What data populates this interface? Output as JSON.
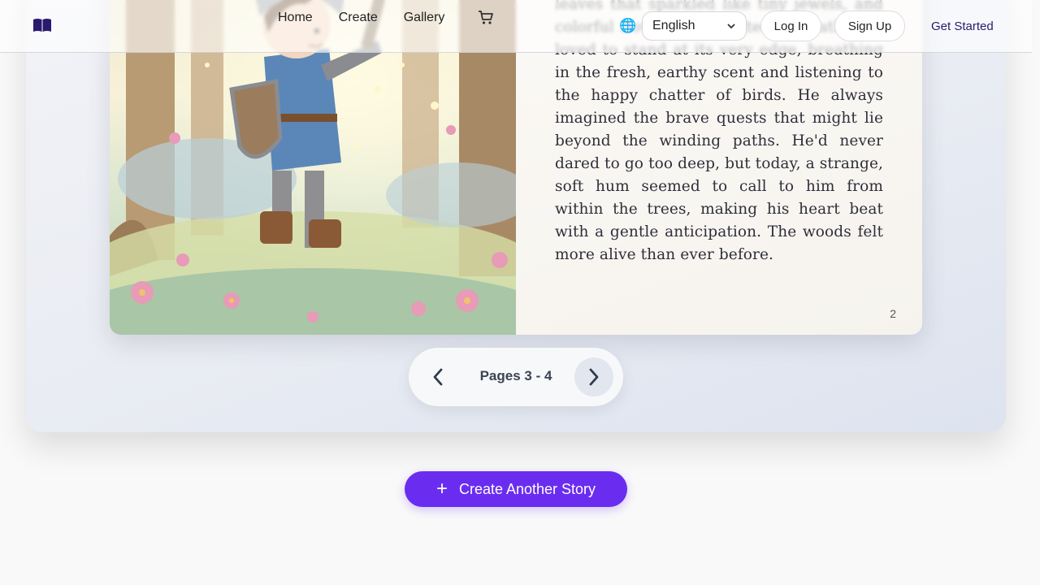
{
  "nav": {
    "links": [
      "Home",
      "Create",
      "Gallery"
    ],
    "language": "English",
    "login_label": "Log In",
    "signup_label": "Sign Up",
    "get_started_label": "Get Started"
  },
  "story": {
    "text": "leaves that sparkled like tiny jewels, and colorful flowers that dotted the path. Leo loved to stand at its very edge, breathing in the fresh, earthy scent and listening to the happy chatter of birds. He always imagined the brave quests that might lie beyond the winding paths. He'd never dared to go too deep, but today, a strange, soft hum seemed to call to him from within the trees, making his heart beat with a gentle anticipation. The woods felt more alive than ever before.",
    "page_number": "2"
  },
  "pager": {
    "label": "Pages 3 - 4"
  },
  "cta": {
    "label": "Create Another Story"
  },
  "colors": {
    "accent": "#6a2df0",
    "brand_dark": "#2a1a6e"
  }
}
